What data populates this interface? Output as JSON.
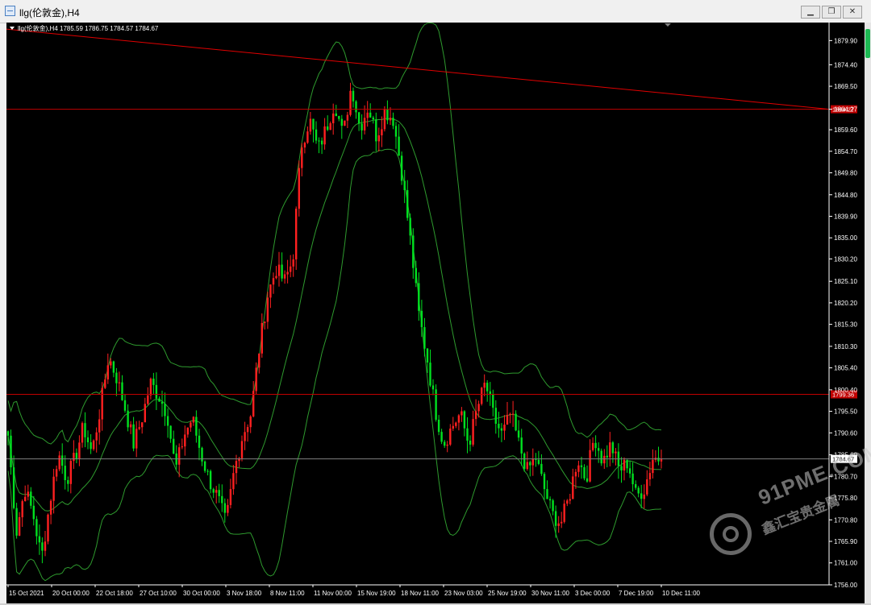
{
  "window": {
    "title": "llg(伦敦金),H4",
    "minimize_label": "▁",
    "restore_label": "❐",
    "close_label": "✕"
  },
  "chart_header": {
    "symbol": "llg(伦敦金),H4",
    "ohlc": "1785.59 1786.75 1784.57 1784.67"
  },
  "colors": {
    "background": "#000000",
    "bull": "#ff2020",
    "bear": "#00e020",
    "bands": "#2e9a2e",
    "level_line": "#c00000",
    "trend_line": "#e00000",
    "axis_text": "#ffffff",
    "current_price_line": "#808080"
  },
  "watermark": {
    "top_text": "91PME.COM",
    "bottom_text": "鑫汇宝贵金属"
  },
  "chart_data": {
    "type": "candlestick",
    "symbol": "llg(伦敦金)",
    "timeframe": "H4",
    "ylim": [
      1756.0,
      1884.0
    ],
    "y_ticks": [
      1879.9,
      1874.4,
      1869.5,
      1864.27,
      1859.6,
      1854.7,
      1849.8,
      1844.8,
      1839.9,
      1835.0,
      1830.2,
      1825.1,
      1820.2,
      1815.3,
      1810.3,
      1805.4,
      1800.4,
      1795.5,
      1790.6,
      1785.6,
      1780.7,
      1775.8,
      1770.8,
      1765.9,
      1761.0,
      1756.0
    ],
    "x_labels": [
      "15 Oct 2021",
      "20 Oct 00:00",
      "22 Oct 18:00",
      "27 Oct 10:00",
      "30 Oct 00:00",
      "3 Nov 18:00",
      "8 Nov 11:00",
      "11 Nov 00:00",
      "15 Nov 19:00",
      "18 Nov 11:00",
      "23 Nov 03:00",
      "25 Nov 19:00",
      "30 Nov 11:00",
      "3 Dec 00:00",
      "7 Dec 19:00",
      "10 Dec 11:00"
    ],
    "horizontal_levels": [
      {
        "label": "1864.27",
        "value": 1864.27,
        "color": "#c00000"
      },
      {
        "label": "1799.36",
        "value": 1799.36,
        "color": "#c00000"
      },
      {
        "label": "1784.67",
        "value": 1784.67,
        "color": "#808080",
        "current": true
      }
    ],
    "trend_line": {
      "start_value": 1882.5,
      "end_value": 1864.27
    },
    "price_path": [
      1790,
      1768,
      1778,
      1772,
      1762,
      1775,
      1786,
      1780,
      1785,
      1792,
      1786,
      1796,
      1808,
      1803,
      1796,
      1788,
      1794,
      1802,
      1799,
      1795,
      1782,
      1790,
      1794,
      1786,
      1780,
      1776,
      1770,
      1782,
      1790,
      1795,
      1810,
      1822,
      1828,
      1825,
      1830,
      1856,
      1862,
      1855,
      1860,
      1866,
      1858,
      1870,
      1860,
      1865,
      1858,
      1864,
      1862,
      1850,
      1835,
      1818,
      1808,
      1796,
      1788,
      1792,
      1795,
      1788,
      1796,
      1802,
      1794,
      1790,
      1795,
      1788,
      1782,
      1785,
      1778,
      1772,
      1770,
      1776,
      1785,
      1780,
      1790,
      1784,
      1788,
      1782,
      1784,
      1776,
      1778,
      1785,
      1784.67
    ],
    "candle_count": 230
  }
}
